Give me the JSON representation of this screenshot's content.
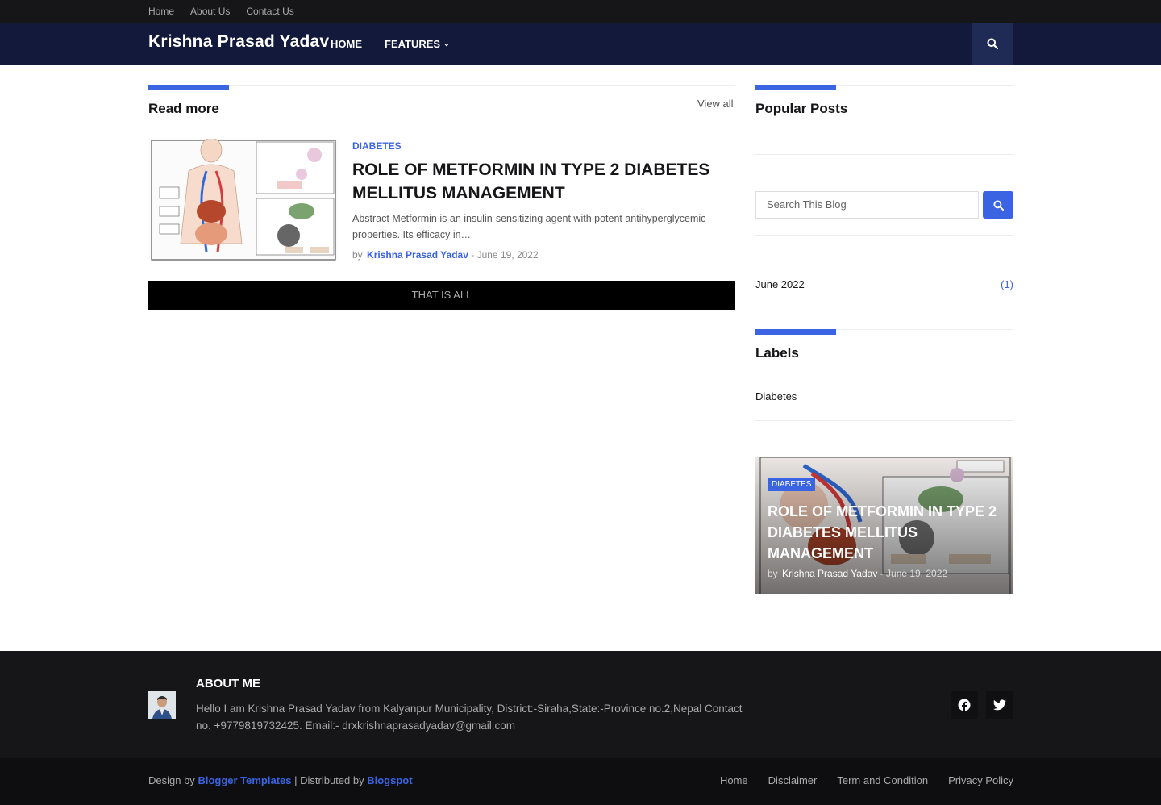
{
  "topbar": {
    "links": [
      "Home",
      "About Us",
      "Contact Us"
    ]
  },
  "header": {
    "logo": "Krishna Prasad Yadav",
    "nav": {
      "home": "HOME",
      "features": "FEATURES"
    },
    "search_icon": "search-icon"
  },
  "main": {
    "section_title": "Read more",
    "view_all": "View all",
    "post": {
      "label": "DIABETES",
      "title": "ROLE OF METFORMIN IN TYPE 2 DIABETES MELLITUS MANAGEMENT",
      "snippet": "Abstract Metformin is an insulin-sensitizing agent with potent antihyperglycemic properties. Its efficacy in…",
      "by": "by",
      "author": "Krishna Prasad Yadav",
      "date": "June 19, 2022"
    },
    "that_is_all": "THAT IS ALL"
  },
  "sidebar": {
    "popular_title": "Popular Posts",
    "search_placeholder": "Search This Blog",
    "archive": {
      "month": "June 2022",
      "count": "(1)"
    },
    "labels_title": "Labels",
    "labels": [
      "Diabetes"
    ],
    "featured": {
      "label": "DIABETES",
      "title": "ROLE OF METFORMIN IN TYPE 2 DIABETES MELLITUS MANAGEMENT",
      "by": "by",
      "author": "Krishna Prasad Yadav",
      "date": "June 19, 2022"
    }
  },
  "footer": {
    "about_title": "ABOUT ME",
    "about_text": "Hello I am Krishna Prasad Yadav from Kalyanpur Municipality, District:-Siraha,State:-Province no.2,Nepal Contact no. +9779819732425. Email:- drxkrishnaprasadyadav@gmail.com",
    "social": [
      "facebook-icon",
      "twitter-icon"
    ],
    "credit": {
      "design_by": "Design by",
      "templates": "Blogger Templates",
      "distributed_by": "| Distributed by",
      "blogspot": "Blogspot"
    },
    "menu": [
      "Home",
      "Disclaimer",
      "Term and Condition",
      "Privacy Policy"
    ]
  },
  "colors": {
    "accent": "#3b64e3",
    "header_bg": "#12193a",
    "topbar_bg": "#161619",
    "footer_bg": "#161619"
  }
}
